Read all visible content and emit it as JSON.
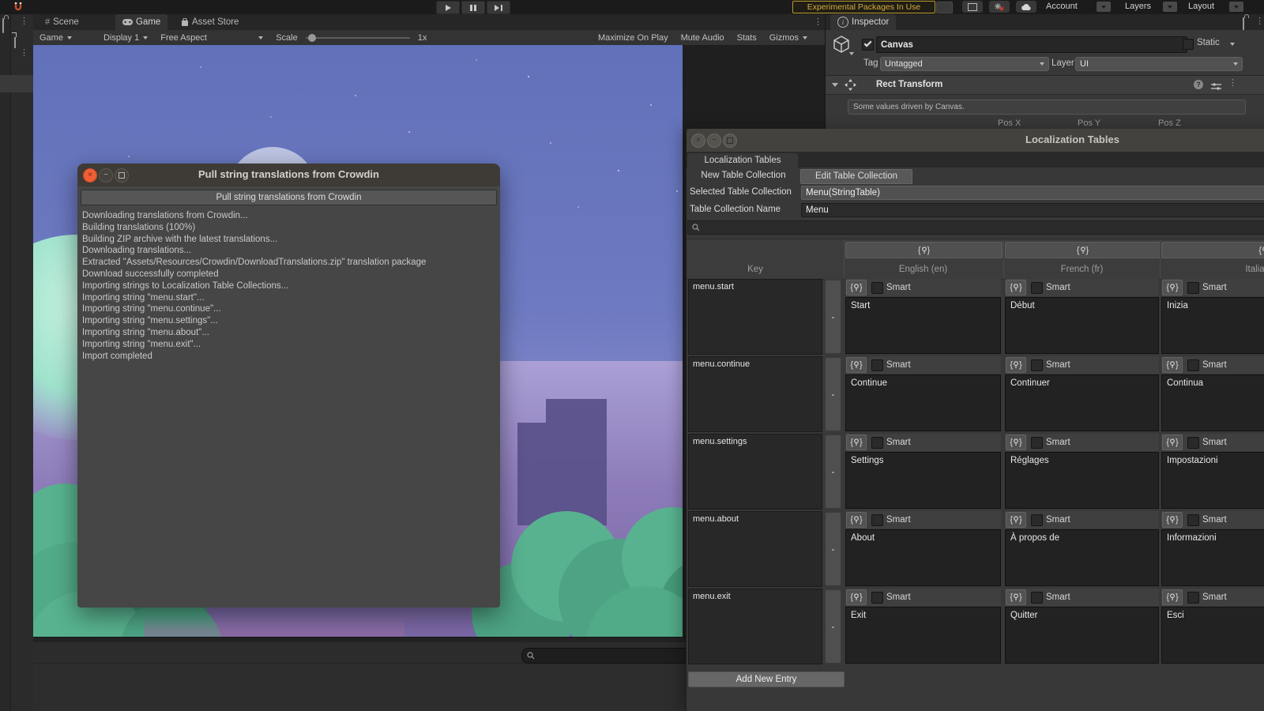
{
  "colors": {
    "experimental_warning": "#d8ac38",
    "ubuntu_close_orange": "#ef5e34",
    "editor_panel": "#383838",
    "sky_top": "#6171ba",
    "ground_purple": "#8d7cb9",
    "bush_green": "#52ab88"
  },
  "topbar": {
    "experimental_button": "Experimental Packages In Use",
    "account_label": "Account",
    "layers_label": "Layers",
    "layout_label": "Layout"
  },
  "game_panel": {
    "tabs": [
      {
        "label": "Scene"
      },
      {
        "label": "Game"
      },
      {
        "label": "Asset Store"
      }
    ],
    "toolbar": {
      "game_dropdown": "Game",
      "display_dropdown": "Display 1",
      "aspect_dropdown": "Free Aspect",
      "scale_label": "Scale",
      "scale_value": "1x",
      "maximize_on_play": "Maximize On Play",
      "mute_audio": "Mute Audio",
      "stats": "Stats",
      "gizmos": "Gizmos"
    }
  },
  "inspector": {
    "tab_label": "Inspector",
    "object_name": "Canvas",
    "static_label": "Static",
    "tag_label": "Tag",
    "tag_value": "Untagged",
    "layer_label": "Layer",
    "layer_value": "UI",
    "component_name": "Rect Transform",
    "info_message": "Some values driven by Canvas.",
    "pos_x_label": "Pos X",
    "pos_y_label": "Pos Y",
    "pos_z_label": "Pos Z"
  },
  "crowdin_dialog": {
    "window_title": "Pull string translations from Crowdin",
    "action_button": "Pull string translations from Crowdin",
    "log_lines": [
      "Downloading translations from Crowdin...",
      "Building translations (100%)",
      "Building ZIP archive with the latest translations...",
      "Downloading translations...",
      "Extracted \"Assets/Resources/Crowdin/DownloadTranslations.zip\" translation package",
      "Download successfully completed",
      "Importing strings to Localization Table Collections...",
      "Importing string \"menu.start\"...",
      "Importing string \"menu.continue\"...",
      "Importing string \"menu.settings\"...",
      "Importing string \"menu.about\"...",
      "Importing string \"menu.exit\"...",
      "Import completed"
    ]
  },
  "localization": {
    "window_title": "Localization Tables",
    "tab_label": "Localization Tables",
    "new_table_collection_button": "New Table Collection",
    "edit_table_collection_button": "Edit Table Collection",
    "selected_table_collection_label": "Selected Table Collection",
    "selected_table_collection_value": "Menu(StringTable)",
    "table_collection_name_label": "Table Collection Name",
    "table_collection_name_value": "Menu",
    "search_value": "",
    "columns": [
      "Key",
      "English (en)",
      "French (fr)",
      "Italian (it)"
    ],
    "smart_label": "Smart",
    "remove_entry_label": "-",
    "add_new_entry_button": "Add New Entry",
    "rows": [
      {
        "key": "menu.start",
        "en": "Start",
        "fr": "Début",
        "it": "Inizia"
      },
      {
        "key": "menu.continue",
        "en": "Continue",
        "fr": "Continuer",
        "it": "Continua"
      },
      {
        "key": "menu.settings",
        "en": "Settings",
        "fr": "Réglages",
        "it": "Impostazioni"
      },
      {
        "key": "menu.about",
        "en": "About",
        "fr": "À propos de",
        "it": "Informazioni"
      },
      {
        "key": "menu.exit",
        "en": "Exit",
        "fr": "Quitter",
        "it": "Esci"
      }
    ]
  }
}
